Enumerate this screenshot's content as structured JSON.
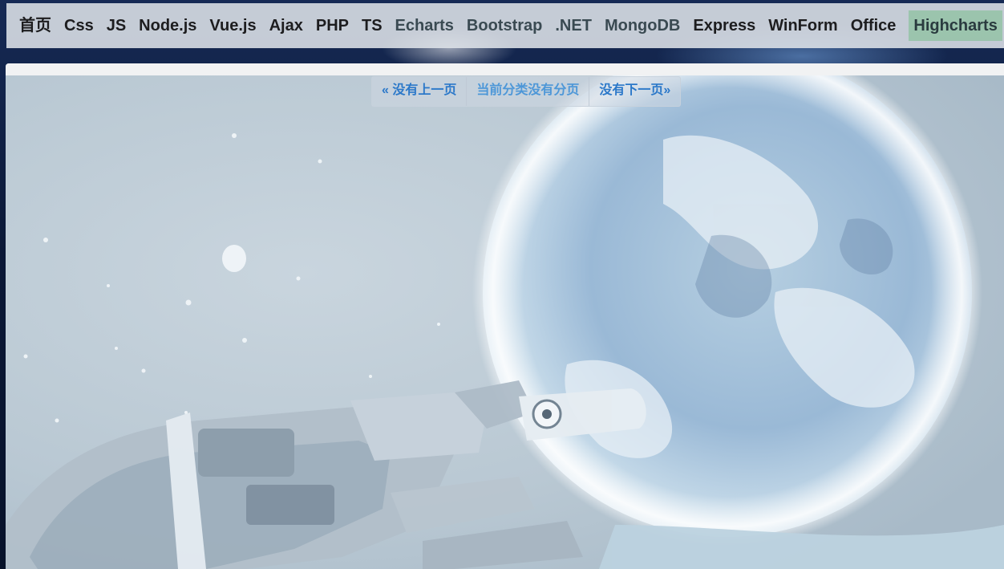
{
  "nav": {
    "items": [
      {
        "label": "首页"
      },
      {
        "label": "Css"
      },
      {
        "label": "JS"
      },
      {
        "label": "Node.js"
      },
      {
        "label": "Vue.js"
      },
      {
        "label": "Ajax"
      },
      {
        "label": "PHP"
      },
      {
        "label": "TS"
      },
      {
        "label": "Echarts"
      },
      {
        "label": "Bootstrap"
      },
      {
        "label": ".NET"
      },
      {
        "label": "MongoDB"
      },
      {
        "label": "Express"
      },
      {
        "label": "WinForm"
      },
      {
        "label": "Office"
      },
      {
        "label": "Highcharts"
      }
    ]
  },
  "pager": {
    "prev_label": "« 没有上一页",
    "current_label": "当前分类没有分页",
    "next_label": "没有下一页»"
  },
  "colors": {
    "link": "#2b78c9",
    "nav_active_bg": "#78be8c"
  }
}
